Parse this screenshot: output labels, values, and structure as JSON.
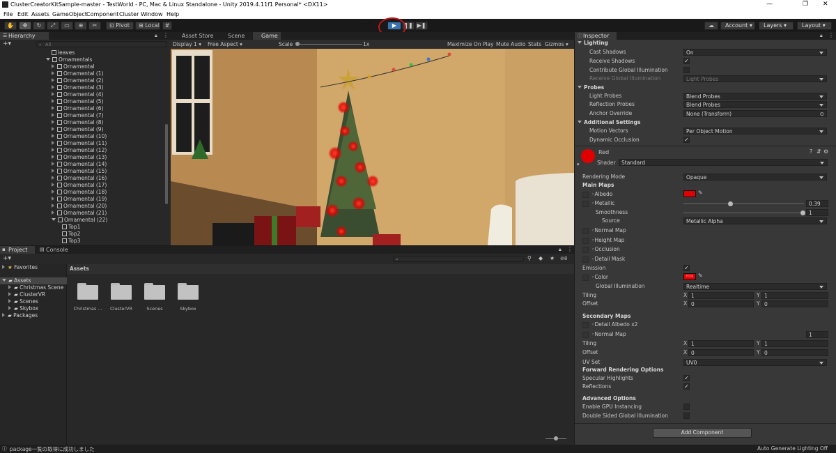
{
  "window": {
    "title": "ClusterCreatorKitSample-master - TestWorld - PC, Mac & Linux Standalone - Unity 2019.4.11f1 Personal* <DX11>",
    "minimize": "—",
    "maximize": "❐",
    "close": "✕"
  },
  "menu": [
    "File",
    "Edit",
    "Assets",
    "GameObject",
    "Component",
    "Cluster",
    "Window",
    "Help"
  ],
  "toolbar": {
    "pivot": "Pivot",
    "local": "Local",
    "account": "Account",
    "layers": "Layers",
    "layout": "Layout",
    "play_icon": "play-icon",
    "pause_icon": "pause-icon",
    "step_icon": "step-icon"
  },
  "hierarchy": {
    "tab": "Hierarchy",
    "search_placeholder": "All",
    "items": [
      {
        "label": "leaves",
        "icon": "cube",
        "expand": ""
      },
      {
        "label": "Ornamentals",
        "icon": "cube",
        "expand": "open"
      },
      {
        "label": "Ornamental",
        "icon": "cube",
        "expand": "closed"
      },
      {
        "label": "Ornamental (1)",
        "icon": "cube",
        "expand": "closed"
      },
      {
        "label": "Ornamental (2)",
        "icon": "cube",
        "expand": "closed"
      },
      {
        "label": "Ornamental (3)",
        "icon": "cube",
        "expand": "closed"
      },
      {
        "label": "Ornamental (4)",
        "icon": "cube",
        "expand": "closed"
      },
      {
        "label": "Ornamental (5)",
        "icon": "cube",
        "expand": "closed"
      },
      {
        "label": "Ornamental (6)",
        "icon": "cube",
        "expand": "closed"
      },
      {
        "label": "Ornamental (7)",
        "icon": "cube",
        "expand": "closed"
      },
      {
        "label": "Ornamental (8)",
        "icon": "cube",
        "expand": "closed"
      },
      {
        "label": "Ornamental (9)",
        "icon": "cube",
        "expand": "closed"
      },
      {
        "label": "Ornamental (10)",
        "icon": "cube",
        "expand": "closed"
      },
      {
        "label": "Ornamental (11)",
        "icon": "cube",
        "expand": "closed"
      },
      {
        "label": "Ornamental (12)",
        "icon": "cube",
        "expand": "closed"
      },
      {
        "label": "Ornamental (13)",
        "icon": "cube",
        "expand": "closed"
      },
      {
        "label": "Ornamental (14)",
        "icon": "cube",
        "expand": "closed"
      },
      {
        "label": "Ornamental (15)",
        "icon": "cube",
        "expand": "closed"
      },
      {
        "label": "Ornamental (16)",
        "icon": "cube",
        "expand": "closed"
      },
      {
        "label": "Ornamental (17)",
        "icon": "cube",
        "expand": "closed"
      },
      {
        "label": "Ornamental (18)",
        "icon": "cube",
        "expand": "closed"
      },
      {
        "label": "Ornamental (19)",
        "icon": "cube",
        "expand": "closed"
      },
      {
        "label": "Ornamental (20)",
        "icon": "cube",
        "expand": "closed"
      },
      {
        "label": "Ornamental (21)",
        "icon": "cube",
        "expand": "closed"
      },
      {
        "label": "Ornamental (22)",
        "icon": "cube",
        "expand": "open"
      },
      {
        "label": "Top1",
        "icon": "cube",
        "expand": ""
      },
      {
        "label": "Top2",
        "icon": "cube",
        "expand": ""
      },
      {
        "label": "Top3",
        "icon": "cube",
        "expand": ""
      }
    ]
  },
  "scene_tabs": {
    "asset_store": "Asset Store",
    "scene": "Scene",
    "game": "Game"
  },
  "game_bar": {
    "display": "Display 1",
    "aspect": "Free Aspect",
    "scale": "Scale",
    "scale_value": "1x",
    "maximize": "Maximize On Play",
    "mute": "Mute Audio",
    "stats": "Stats",
    "gizmos": "Gizmos"
  },
  "project": {
    "tab_project": "Project",
    "tab_console": "Console",
    "favorites": "Favorites",
    "assets": "Assets",
    "tree": [
      "Christmas Scene",
      "ClusterVR",
      "Scenes",
      "Skybox"
    ],
    "packages": "Packages",
    "header": "Assets",
    "count": "8",
    "folders": [
      "Christmas ...",
      "ClusterVR",
      "Scenes",
      "Skybox"
    ]
  },
  "status": {
    "message": "package一覧の取得に成功しました",
    "lighting": "Auto Generate Lighting Off"
  },
  "inspector": {
    "tab": "Inspector",
    "lighting": "Lighting",
    "cast_shadows": "Cast Shadows",
    "cast_shadows_value": "On",
    "receive_shadows": "Receive Shadows",
    "contribute_gi": "Contribute Global Illumination",
    "receive_gi": "Receive Global Illumination",
    "receive_gi_value": "Light Probes",
    "probes": "Probes",
    "light_probes": "Light Probes",
    "light_probes_value": "Blend Probes",
    "reflection_probes": "Reflection Probes",
    "reflection_probes_value": "Blend Probes",
    "anchor_override": "Anchor Override",
    "anchor_override_value": "None (Transform)",
    "additional": "Additional Settings",
    "motion_vectors": "Motion Vectors",
    "motion_vectors_value": "Per Object Motion",
    "dynamic_occlusion": "Dynamic Occlusion",
    "material_name": "Red",
    "shader_label": "Shader",
    "shader_value": "Standard",
    "rendering_mode": "Rendering Mode",
    "rendering_mode_value": "Opaque",
    "main_maps": "Main Maps",
    "albedo": "Albedo",
    "metallic": "Metallic",
    "metallic_value": "0.39",
    "metallic_level": 0.39,
    "smoothness": "Smoothness",
    "smoothness_value": "1",
    "smoothness_level": 1,
    "source": "Source",
    "source_value": "Metallic Alpha",
    "normal_map": "Normal Map",
    "height_map": "Height Map",
    "occlusion": "Occlusion",
    "detail_mask": "Detail Mask",
    "emission": "Emission",
    "color": "Color",
    "color_text": "HDR",
    "global_illumination": "Global Illumination",
    "global_illumination_value": "Realtime",
    "tiling": "Tiling",
    "offset": "Offset",
    "x": "X",
    "y": "Y",
    "tiling_x": "1",
    "tiling_y": "1",
    "offset_x": "0",
    "offset_y": "0",
    "secondary_maps": "Secondary Maps",
    "detail_albedo": "Detail Albedo x2",
    "sec_normal_map": "Normal Map",
    "sec_normal_value": "1",
    "sec_tiling_x": "1",
    "sec_tiling_y": "1",
    "sec_offset_x": "0",
    "sec_offset_y": "0",
    "uv_set": "UV Set",
    "uv_set_value": "UV0",
    "forward_options": "Forward Rendering Options",
    "specular": "Specular Highlights",
    "reflections": "Reflections",
    "advanced": "Advanced Options",
    "gpu_instancing": "Enable GPU Instancing",
    "double_sided": "Double Sided Global Illumination",
    "add_component": "Add Component"
  },
  "colors": {
    "accent": "#3a72b0",
    "material": "#e00000",
    "play_ring": "#c0181a"
  }
}
